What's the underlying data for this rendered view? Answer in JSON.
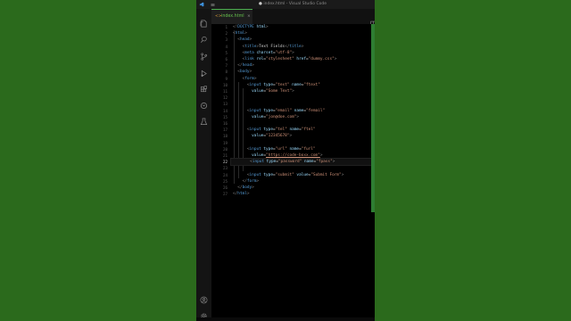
{
  "window": {
    "title": "index.html - Visual Studio Code",
    "dirty_dot": "●"
  },
  "tab": {
    "icon": "<>",
    "label": "index.html",
    "close": "×"
  },
  "toolbar": {
    "more": "···"
  },
  "line_numbers": [
    "1",
    "2",
    "3",
    "4",
    "5",
    "6",
    "7",
    "8",
    "9",
    "10",
    "11",
    "12",
    "13",
    "14",
    "15",
    "16",
    "17",
    "18",
    "19",
    "20",
    "21",
    "22",
    "23",
    "24",
    "25",
    "26",
    "27"
  ],
  "active_line": "22",
  "code": {
    "l1": {
      "a": "<!",
      "b": "DOCTYPE",
      "c": " html",
      "d": ">"
    },
    "l2": {
      "a": "<",
      "b": "html",
      "c": ">"
    },
    "l3": {
      "a": "<",
      "b": "head",
      "c": ">"
    },
    "l4": {
      "a": "<",
      "b": "title",
      "c": ">",
      "d": "Text Fields",
      "e": "</",
      "f": "title",
      "g": ">"
    },
    "l5": {
      "a": "<",
      "b": "meta",
      "c": " charset",
      "d": "=",
      "e": "\"utf-8\"",
      "f": ">"
    },
    "l6": {
      "a": "<",
      "b": "link",
      "c": " rel",
      "d": "=",
      "e": "\"stylesheet\"",
      "f": " href",
      "g": "=",
      "h": "\"dummy.css\"",
      "i": ">"
    },
    "l7": {
      "a": "</",
      "b": "head",
      "c": ">"
    },
    "l8": {
      "a": "<",
      "b": "body",
      "c": ">"
    },
    "l9": {
      "a": "<",
      "b": "form",
      "c": ">"
    },
    "l10": {
      "a": "<",
      "b": "input",
      "c": " type",
      "d": "=",
      "e": "\"text\"",
      "f": " name",
      "g": "=",
      "h": "\"ftext\""
    },
    "l11": {
      "a": "value",
      "b": "=",
      "c": "\"Some Text\"",
      "d": ">"
    },
    "l13": {
      "a": "<",
      "b": "input",
      "c": " type",
      "d": "=",
      "e": "\"email\"",
      "f": " name",
      "g": "=",
      "h": "\"femail\""
    },
    "l14": {
      "a": "value",
      "b": "=",
      "c": "\"jon@doe.com\"",
      "d": ">"
    },
    "l16": {
      "a": "<",
      "b": "input",
      "c": " type",
      "d": "=",
      "e": "\"tel\"",
      "f": " name",
      "g": "=",
      "h": "\"ftel\""
    },
    "l17": {
      "a": "value",
      "b": "=",
      "c": "\"12345678\"",
      "d": ">"
    },
    "l19": {
      "a": "<",
      "b": "input",
      "c": " type",
      "d": "=",
      "e": "\"url\"",
      "f": " name",
      "g": "=",
      "h": "\"furl\""
    },
    "l20": {
      "a": "value",
      "b": "=",
      "c": "\"https://code-boxx.com\"",
      "d": ">"
    },
    "l22": {
      "a": "<",
      "b": "input",
      "c": " type",
      "d": "=",
      "e": "\"password\"",
      "f": " name",
      "g": "=",
      "h": "\"fpass\"",
      "i": ">"
    },
    "l24": {
      "a": "<",
      "b": "input",
      "c": " type",
      "d": "=",
      "e": "\"submit\"",
      "f": " value",
      "g": "=",
      "h": "\"Submit Form\"",
      "i": ">"
    },
    "l25": {
      "a": "</",
      "b": "form",
      "c": ">"
    },
    "l26": {
      "a": "</",
      "b": "body",
      "c": ">"
    },
    "l27": {
      "a": "</",
      "b": "html",
      "c": ">"
    }
  },
  "colors": {
    "background": "#2b6a1c",
    "editor": "#000000",
    "tag": "#569cd6",
    "attribute": "#9cdcfe",
    "string": "#ce9178",
    "accent": "#4caf50"
  },
  "icons": {
    "activity_bar": [
      "vs-code-logo-icon",
      "menu-icon",
      "explorer-icon",
      "search-icon",
      "source-control-icon",
      "run-debug-icon",
      "extensions-icon",
      "remote-icon",
      "testing-icon",
      "account-icon",
      "settings-gear-icon"
    ]
  }
}
